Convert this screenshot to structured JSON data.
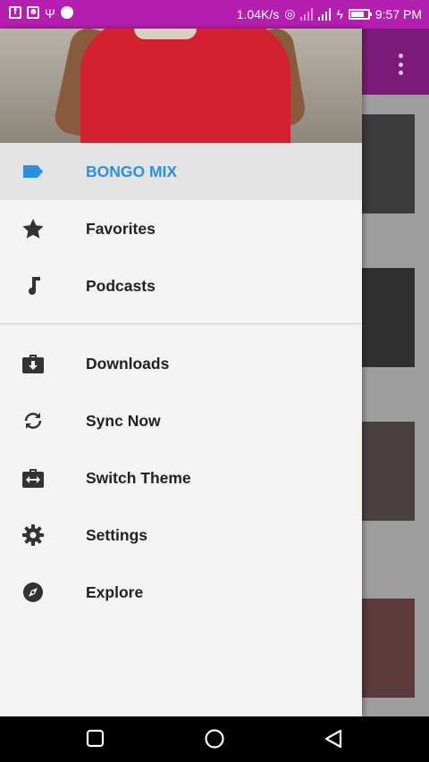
{
  "status_bar": {
    "speed": "1.04K/s",
    "time": "9:57 PM"
  },
  "drawer": {
    "header_image": "woman-in-red-dress-photo",
    "items": [
      {
        "label": "BONGO MIX",
        "icon": "label-tag-icon",
        "active": true
      },
      {
        "label": "Favorites",
        "icon": "star-icon",
        "active": false
      },
      {
        "label": "Podcasts",
        "icon": "music-note-icon",
        "active": false
      },
      {
        "label": "Downloads",
        "icon": "download-briefcase-icon",
        "active": false
      },
      {
        "label": "Sync Now",
        "icon": "sync-icon",
        "active": false
      },
      {
        "label": "Switch Theme",
        "icon": "switch-theme-icon",
        "active": false
      },
      {
        "label": "Settings",
        "icon": "gear-icon",
        "active": false
      },
      {
        "label": "Explore",
        "icon": "compass-icon",
        "active": false
      }
    ]
  },
  "colors": {
    "status_bar": "#b51fb0",
    "accent": "#2b8fe0",
    "drawer_bg": "#f3f3f3"
  }
}
